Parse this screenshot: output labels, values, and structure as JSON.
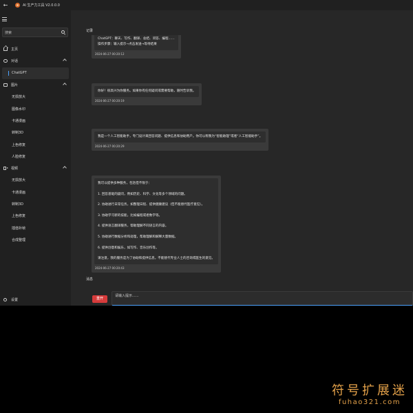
{
  "window": {
    "title": "AI 生产力工具 V2.0.0.0"
  },
  "sidebar": {
    "search_placeholder": "搜索",
    "home": "主页",
    "groups": [
      {
        "label": "对话",
        "items": [
          "ChatGPT"
        ]
      },
      {
        "label": "图片",
        "items": [
          "无损放大",
          "图像水印",
          "卡通漫画",
          "转制3D",
          "上色修复",
          "人脸修复"
        ]
      },
      {
        "label": "视频",
        "items": [
          "无损放大",
          "卡通漫画",
          "转制3D",
          "上色修复",
          "插值补帧",
          "合成整理"
        ]
      }
    ],
    "selected_item": "ChatGPT",
    "settings": "设置"
  },
  "main": {
    "records_label": "记录",
    "messages_label": "消息",
    "messages": [
      {
        "lines": [
          "ChatGPT：聊天、写作、翻译、总结、问答、编程……",
          "操作步骤：输入提示→点击发送→等待结果"
        ],
        "timestamp": "2024-06-27 00:20:12"
      },
      {
        "lines": [
          "你好！很高兴为你服务。如果你有任何疑问或需要帮助，随时告诉我。"
        ],
        "timestamp": "2024-06-27 00:20:19"
      },
      {
        "lines": [
          "我是一个人工智能助手，专门设计来回答问题、提供信息和协助用户。你可以称我为“智能助理”或者“人工智能助手”。"
        ],
        "timestamp": "2024-06-27 00:20:29"
      },
      {
        "lines": [
          "我可以提供多种服务，包括但不限于：",
          "1. 回答基础的疑问，例如历史、科学、文化等多个领域的问题。",
          "2. 协助进行日常任务，如整理日程、提供健康建议（但不能替代医疗意见）。",
          "3. 协助学习新的技能，比如编程或者数学等。",
          "4. 提供语言翻译服务，帮助理解不同语言的内容。",
          "5. 协助进行数据分析和处理，帮助理解和解释大量数据。",
          "6. 提供创意和娱乐，如写作、音乐创作等。",
          "请注意，我的服务是为了协助和提供信息，不能替代专业人士的咨询或医生的意见。"
        ],
        "timestamp": "2024-06-27 00:20:43"
      }
    ],
    "reset_label": "重开",
    "input_placeholder": "请输入提示......"
  },
  "watermark": {
    "cn": "符号扩展迷",
    "en": "fuhao321.com"
  }
}
